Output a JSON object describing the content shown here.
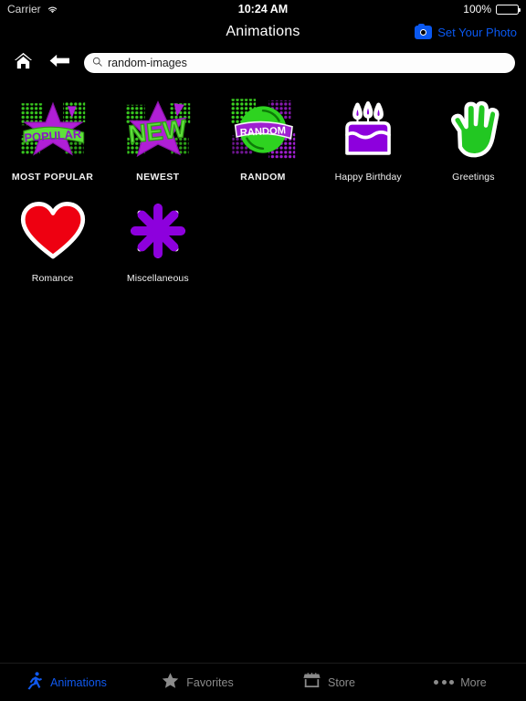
{
  "status_bar": {
    "carrier": "Carrier",
    "wifi_icon": "wifi-icon",
    "time": "10:24 AM",
    "battery_percent": "100%",
    "battery_icon": "battery-icon"
  },
  "nav_bar": {
    "title": "Animations",
    "action_label": "Set Your Photo",
    "action_icon": "camera-icon"
  },
  "toolbar": {
    "home_icon": "home-icon",
    "back_icon": "back-arrow-icon",
    "search": {
      "icon": "search-icon",
      "value": "random-images",
      "placeholder": "Search"
    }
  },
  "colors": {
    "accent_blue": "#1059ef",
    "purple": "#9400e0",
    "green": "#22cc22",
    "red": "#ee0011",
    "inactive_gray": "#8b8b8b",
    "background": "#000000"
  },
  "grid": {
    "items": [
      {
        "label": "MOST POPULAR",
        "art": "popular-badge-art",
        "caps": true,
        "badge_text": "POPULAR"
      },
      {
        "label": "NEWEST",
        "art": "new-burst-art",
        "caps": true,
        "badge_text": "NEW"
      },
      {
        "label": "RANDOM",
        "art": "random-badge-art",
        "caps": true,
        "badge_text": "RANDOM"
      },
      {
        "label": "Happy Birthday",
        "art": "birthday-cake-art",
        "caps": false,
        "badge_text": ""
      },
      {
        "label": "Greetings",
        "art": "waving-hand-art",
        "caps": false,
        "badge_text": ""
      },
      {
        "label": "Romance",
        "art": "heart-art",
        "caps": false,
        "badge_text": ""
      },
      {
        "label": "Miscellaneous",
        "art": "asterisk-flower-art",
        "caps": false,
        "badge_text": ""
      }
    ]
  },
  "tab_bar": {
    "items": [
      {
        "label": "Animations",
        "icon": "running-person-icon",
        "active": true
      },
      {
        "label": "Favorites",
        "icon": "star-icon",
        "active": false
      },
      {
        "label": "Store",
        "icon": "storefront-icon",
        "active": false
      },
      {
        "label": "More",
        "icon": "ellipsis-icon",
        "active": false
      }
    ]
  }
}
